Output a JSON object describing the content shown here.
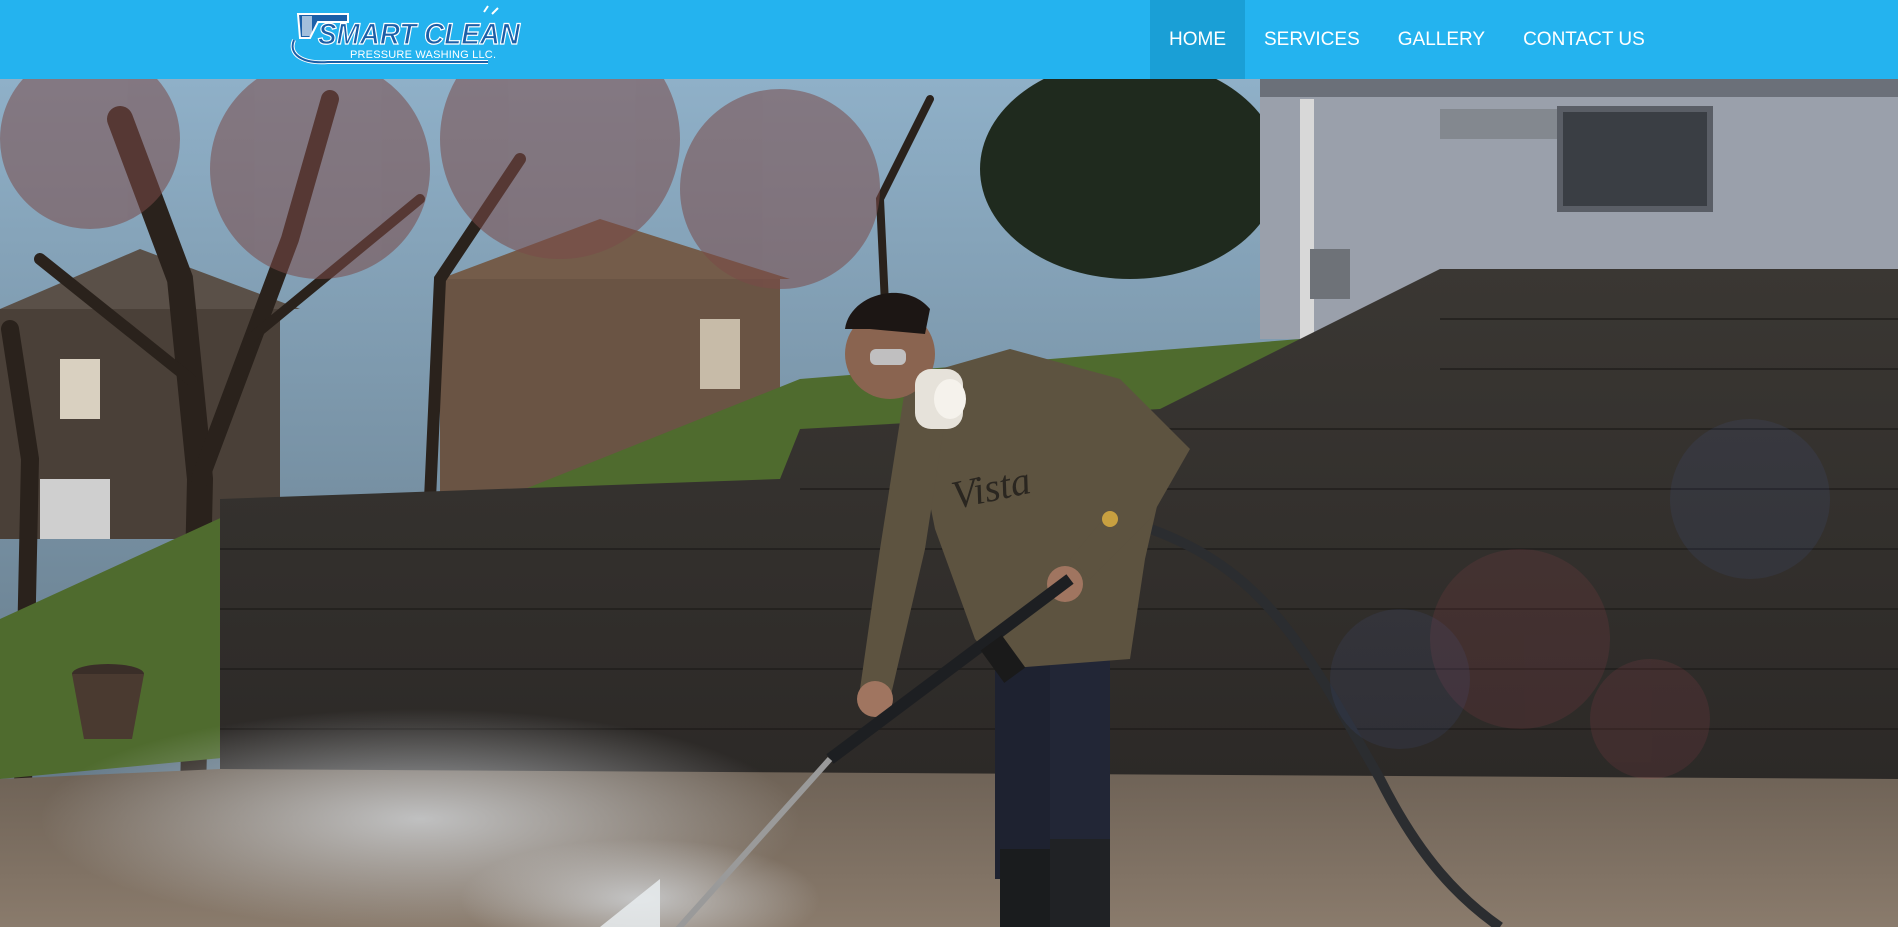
{
  "header": {
    "logo": {
      "brand_line1": "SMART CLEAN",
      "brand_line2": "PRESSURE WASHING LLC.",
      "icon": "pressure-washer-gun-icon"
    },
    "nav": [
      {
        "label": "HOME",
        "active": true
      },
      {
        "label": "SERVICES",
        "active": false
      },
      {
        "label": "GALLERY",
        "active": false
      },
      {
        "label": "CONTACT US",
        "active": false
      }
    ]
  },
  "hero": {
    "shirt_text": "Vista"
  },
  "colors": {
    "header_bg": "#24b3ef",
    "nav_active_bg": "#1a9fd6",
    "nav_text": "#ffffff"
  }
}
